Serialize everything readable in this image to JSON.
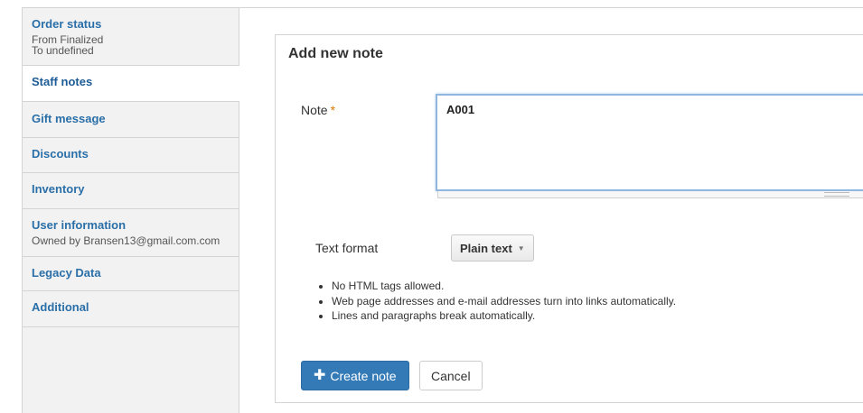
{
  "sidebar": {
    "tabs": [
      {
        "title": "Order status",
        "summary_lines": [
          "From Finalized",
          "To undefined"
        ],
        "active": false
      },
      {
        "title": "Staff notes",
        "summary_lines": [],
        "active": true
      },
      {
        "title": "Gift message",
        "summary_lines": [],
        "active": false
      },
      {
        "title": "Discounts",
        "summary_lines": [],
        "active": false
      },
      {
        "title": "Inventory",
        "summary_lines": [],
        "active": false
      },
      {
        "title": "User information",
        "summary_lines": [
          "Owned by Bransen13@gmail.com.com"
        ],
        "active": false
      },
      {
        "title": "Legacy Data",
        "summary_lines": [],
        "active": false
      },
      {
        "title": "Additional",
        "summary_lines": [],
        "active": false
      }
    ]
  },
  "form": {
    "legend": "Add new note",
    "note_label": "Note",
    "required_marker": "*",
    "note_value": "A001",
    "text_format_label": "Text format",
    "text_format_selected": "Plain text",
    "tips": [
      "No HTML tags allowed.",
      "Web page addresses and e-mail addresses turn into links automatically.",
      "Lines and paragraphs break automatically."
    ],
    "create_button_label": "Create note",
    "cancel_button_label": "Cancel"
  },
  "colors": {
    "link_blue": "#2a6fa8",
    "primary_button": "#337ab7",
    "required_marker": "#e07a00",
    "sidebar_background": "#f2f2f2",
    "focus_border": "#8fb7e0"
  },
  "icons": {
    "create_button_icon": "plus-icon",
    "select_caret": "caret-down-icon",
    "textarea_grip": "resize-grip-icon"
  }
}
